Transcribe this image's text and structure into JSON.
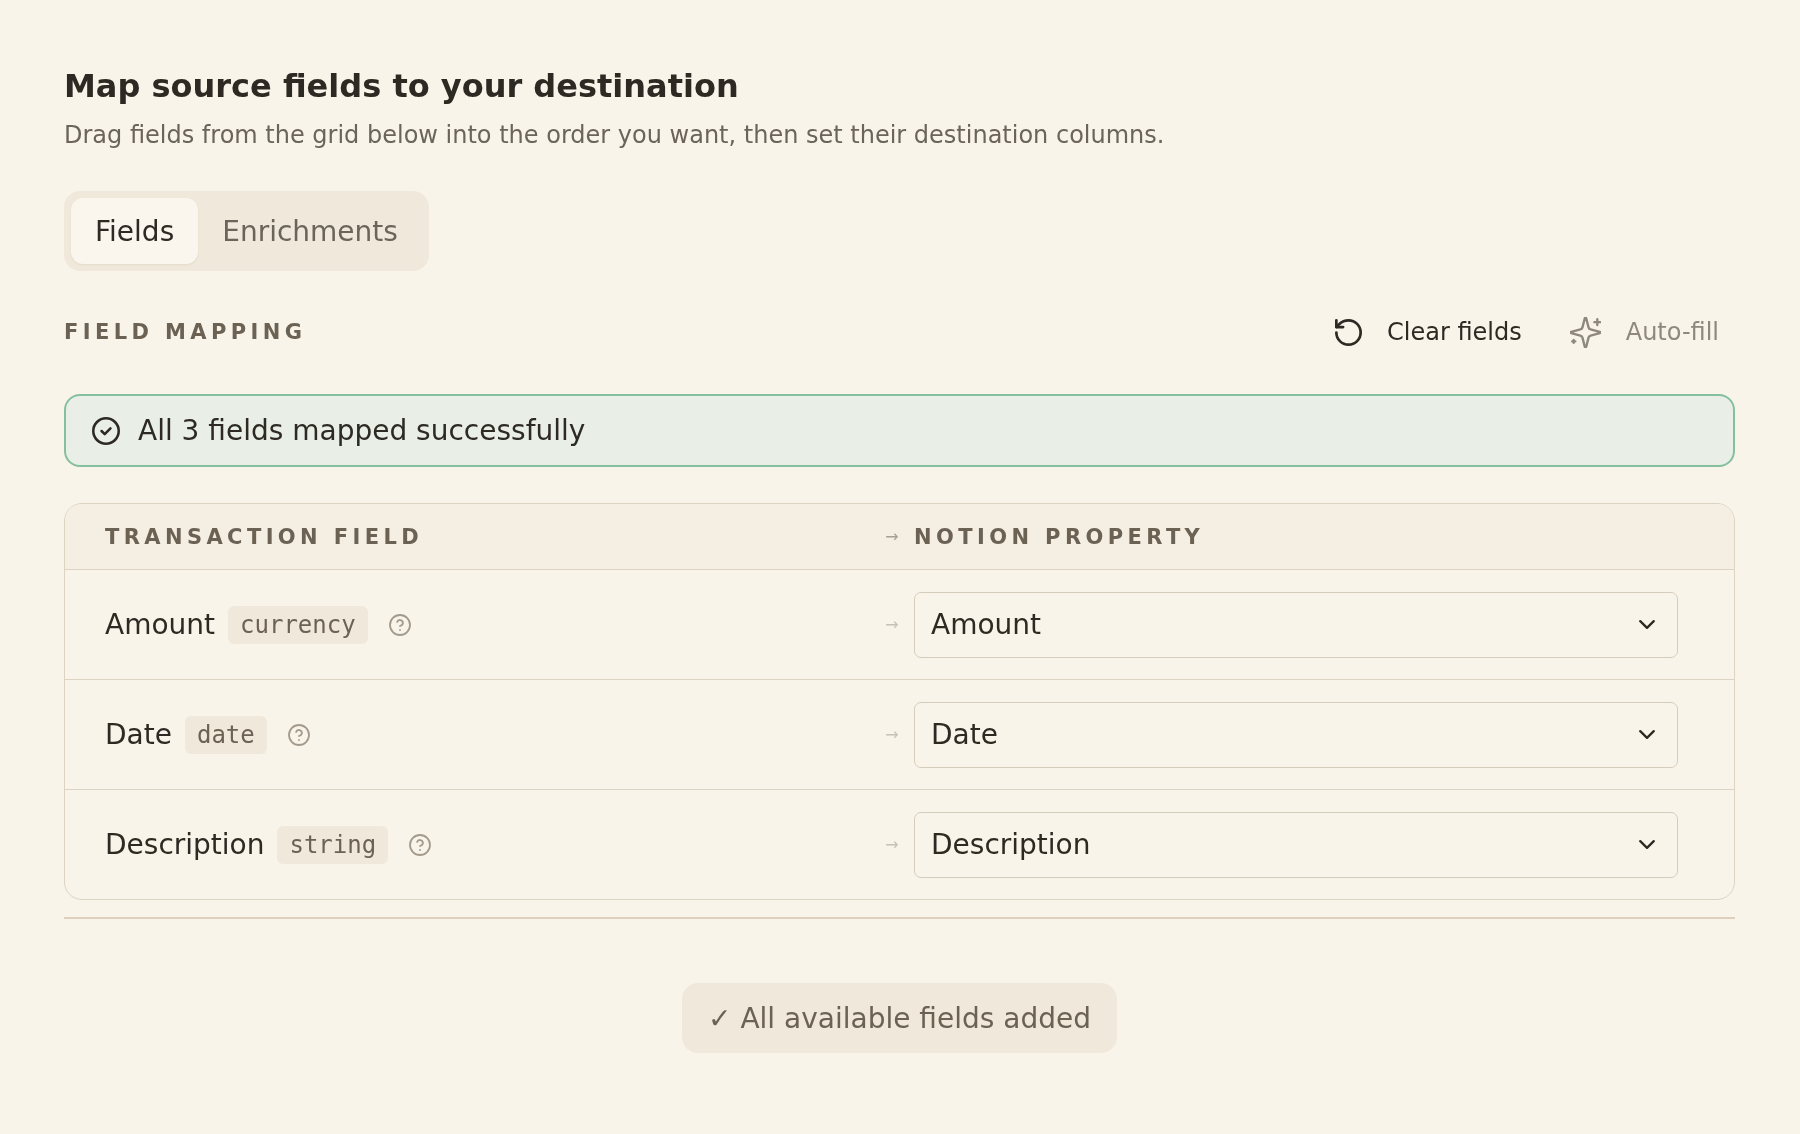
{
  "header": {
    "title": "Map source fields to your destination",
    "subtitle": "Drag fields from the grid below into the order you want, then set their destination columns."
  },
  "tabs": [
    {
      "label": "Fields",
      "selected": true
    },
    {
      "label": "Enrichments",
      "selected": false
    }
  ],
  "field_mapping": {
    "heading": "FIELD MAPPING",
    "actions": [
      {
        "kind": "reset",
        "label": "Clear fields",
        "disabled": false
      },
      {
        "kind": "sparkle",
        "label": "Auto-fill",
        "disabled": true
      }
    ],
    "status_banner": {
      "message": "All 3 fields mapped successfully"
    },
    "table": {
      "columns": [
        {
          "label": "TRANSACTION FIELD"
        },
        {
          "label": "NOTION PROPERTY"
        }
      ],
      "header_arrow": "→",
      "rows": [
        {
          "field": "Amount",
          "type": "currency",
          "arrow": "→",
          "property": "Amount"
        },
        {
          "field": "Date",
          "type": "date",
          "arrow": "→",
          "property": "Date"
        },
        {
          "field": "Description",
          "type": "string",
          "arrow": "→",
          "property": "Description"
        }
      ]
    },
    "footer_status": "✓ All available fields added"
  }
}
